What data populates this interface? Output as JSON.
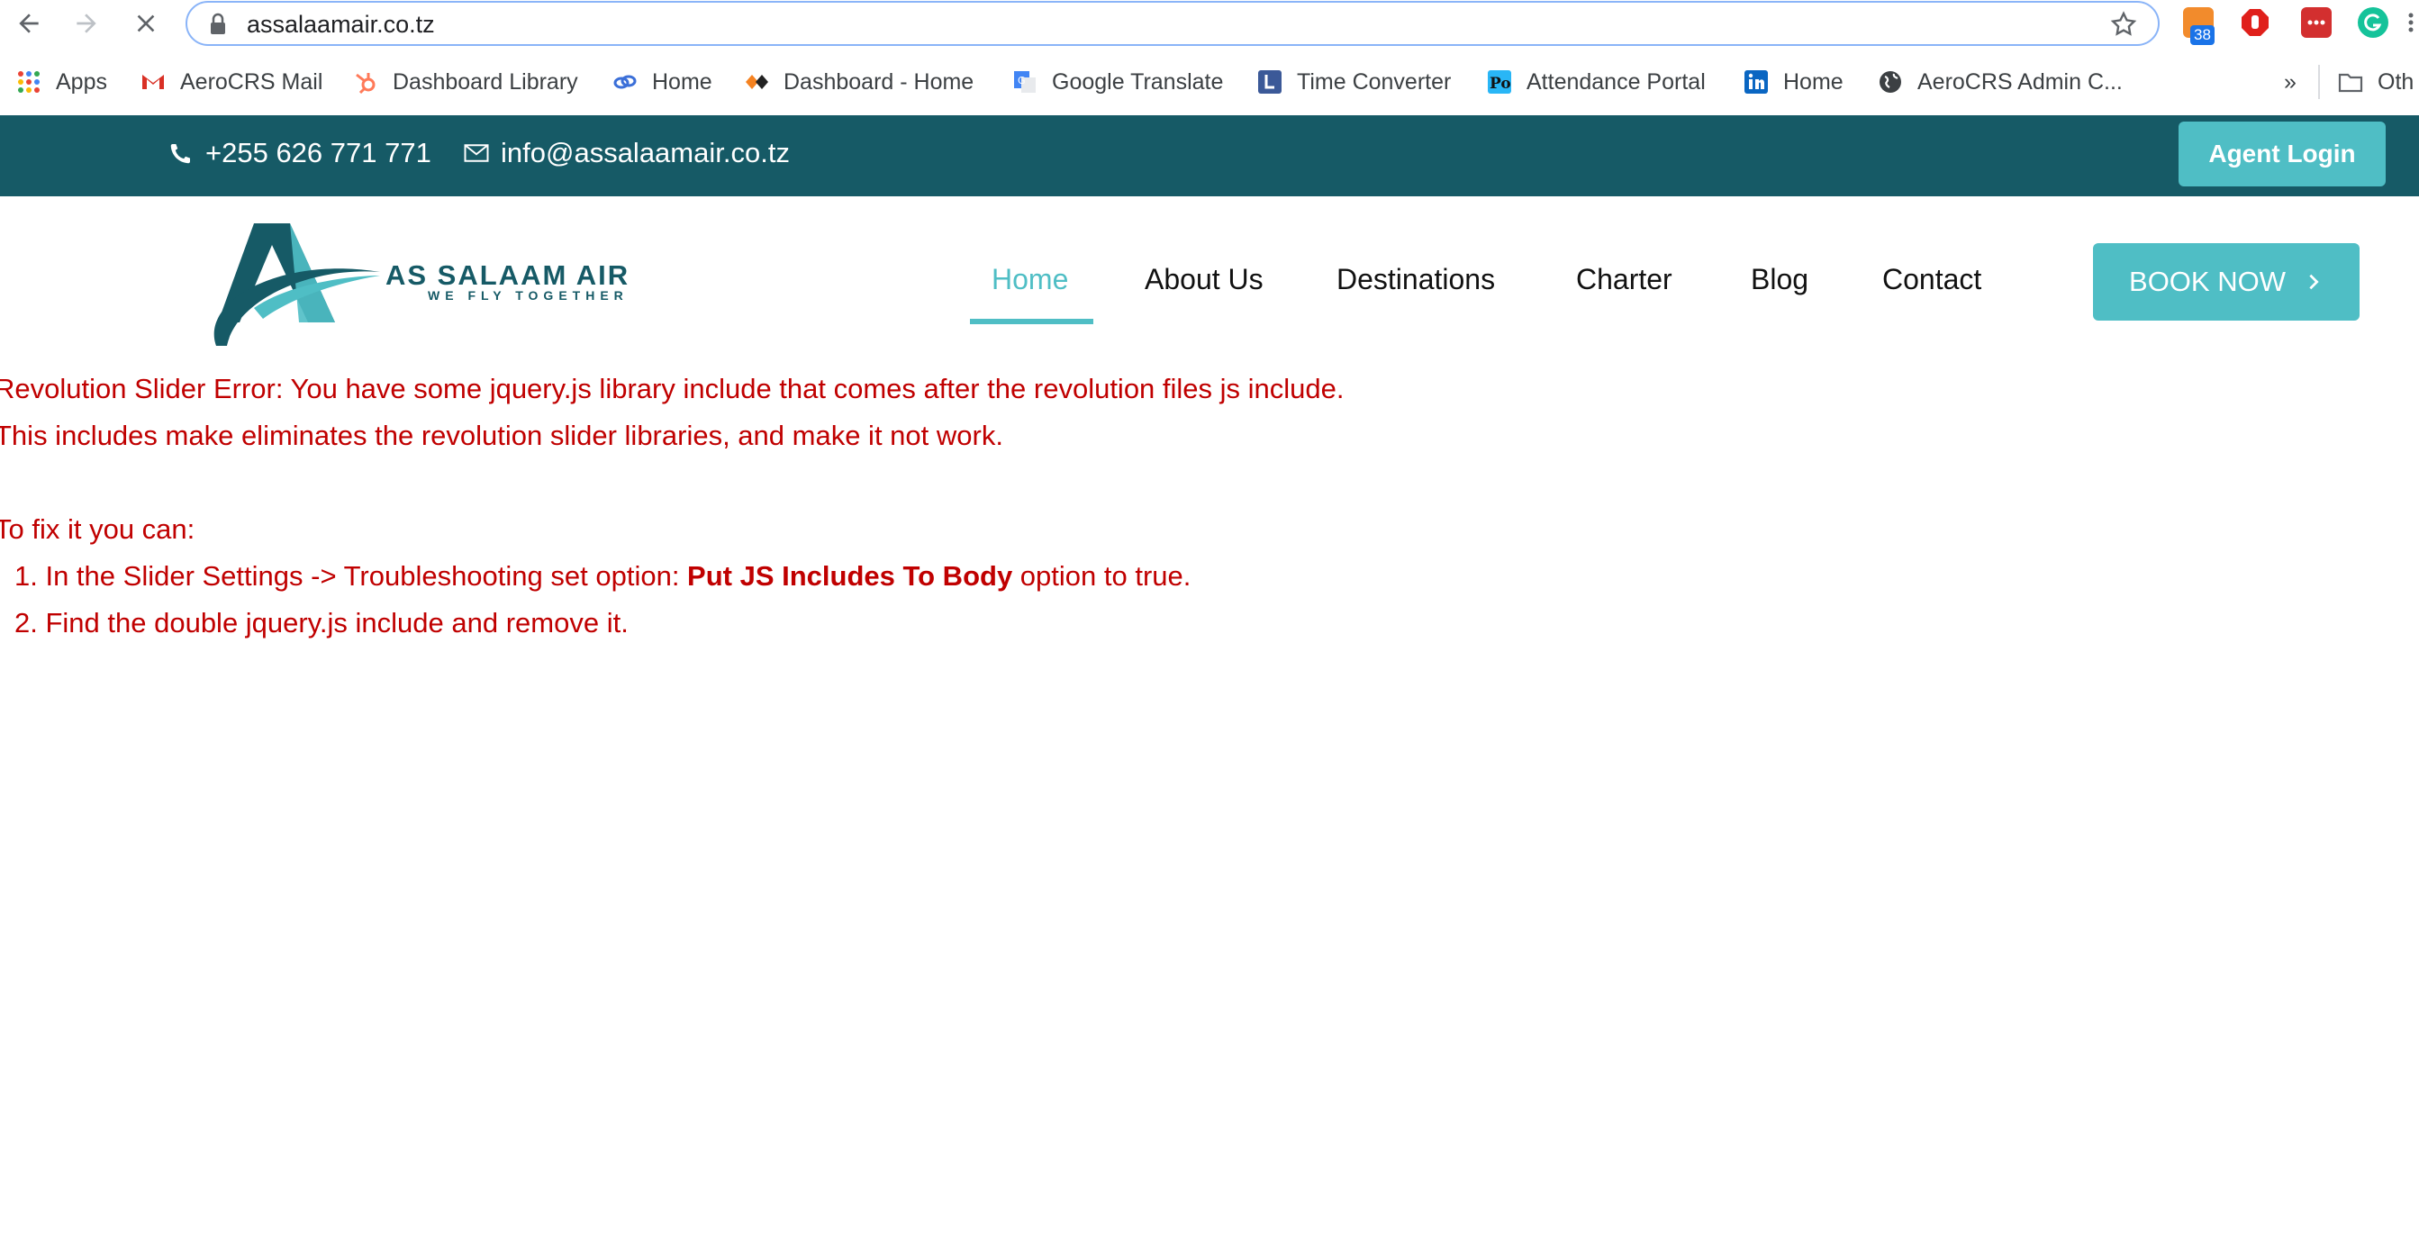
{
  "browser": {
    "url": "assalaamair.co.tz",
    "extension_badge": "38",
    "bookmarks": [
      {
        "label": "Apps",
        "icon": "apps-grid-icon"
      },
      {
        "label": "AeroCRS Mail",
        "icon": "gmail-icon"
      },
      {
        "label": "Dashboard Library",
        "icon": "hubspot-icon"
      },
      {
        "label": "Home",
        "icon": "link-icon"
      },
      {
        "label": "Dashboard - Home",
        "icon": "diamond-icon"
      },
      {
        "label": "Google Translate",
        "icon": "google-translate-icon"
      },
      {
        "label": "Time Converter",
        "icon": "clock-icon"
      },
      {
        "label": "Attendance Portal",
        "icon": "attendance-icon"
      },
      {
        "label": "Home",
        "icon": "linkedin-icon"
      },
      {
        "label": "AeroCRS Admin C...",
        "icon": "globe-icon"
      }
    ],
    "overflow": "»",
    "other_bookmarks": "Oth"
  },
  "topbar": {
    "phone": "+255 626 771 771",
    "email": "info@assalaamair.co.tz",
    "agent_login": "Agent Login"
  },
  "header": {
    "logo_text": "AS SALAAM AIR",
    "logo_tagline": "WE FLY TOGETHER",
    "menu": [
      "Home",
      "About Us",
      "Destinations",
      "Charter",
      "Blog",
      "Contact"
    ],
    "active_menu": "Home",
    "book_now": "BOOK NOW"
  },
  "error": {
    "line1": "Revolution Slider Error: You have some jquery.js library include that comes after the revolution files js include.",
    "line2": "This includes make eliminates the revolution slider libraries, and make it not work.",
    "fix_intro": "To fix it you can:",
    "step1_prefix": "1. In the Slider Settings -> Troubleshooting set option: ",
    "step1_bold": "Put JS Includes To Body",
    "step1_suffix": " option to true.",
    "step2": "2. Find the double jquery.js include and remove it."
  },
  "colors": {
    "topbar_bg": "#165a66",
    "accent": "#4fbec5",
    "error_text": "#c00000"
  }
}
